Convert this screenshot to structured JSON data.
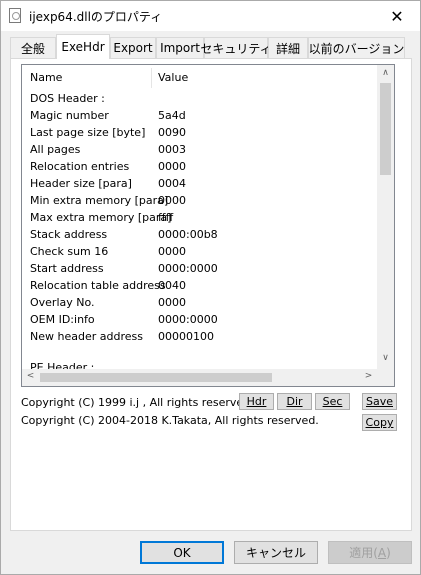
{
  "window": {
    "title": "ijexp64.dllのプロパティ",
    "close_glyph": "✕"
  },
  "tabs": [
    {
      "label": "全般"
    },
    {
      "label": "ExeHdr",
      "active": true
    },
    {
      "label": "Export"
    },
    {
      "label": "Import"
    },
    {
      "label": "セキュリティ"
    },
    {
      "label": "詳細"
    },
    {
      "label": "以前のバージョン"
    }
  ],
  "list": {
    "columns": [
      "Name",
      "Value"
    ],
    "rows": [
      {
        "name": "DOS Header :",
        "value": ""
      },
      {
        "name": "Magic number",
        "value": "5a4d"
      },
      {
        "name": "Last page size [byte]",
        "value": "0090"
      },
      {
        "name": "All pages",
        "value": "0003"
      },
      {
        "name": "Relocation entries",
        "value": "0000"
      },
      {
        "name": "Header size [para]",
        "value": "0004"
      },
      {
        "name": "Min extra memory [para]",
        "value": "0000"
      },
      {
        "name": "Max extra memory [para]",
        "value": "ffff"
      },
      {
        "name": "Stack address",
        "value": "0000:00b8"
      },
      {
        "name": "Check sum 16",
        "value": "0000"
      },
      {
        "name": "Start address",
        "value": "0000:0000"
      },
      {
        "name": "Relocation table address",
        "value": "0040"
      },
      {
        "name": "Overlay No.",
        "value": "0000"
      },
      {
        "name": "OEM ID:info",
        "value": "0000:0000"
      },
      {
        "name": "New header address",
        "value": "00000100"
      },
      {
        "name": "",
        "value": ""
      },
      {
        "name": "PE Header :",
        "value": ""
      }
    ]
  },
  "footer": {
    "copyright1": "Copyright (C) 1999 i.j , All rights reserved.",
    "copyright2": "Copyright (C) 2004-2018 K.Takata, All rights reserved.",
    "buttons": {
      "hdr": "Hdr",
      "dir": "Dir",
      "sec": "Sec",
      "save": "Save",
      "copy": "Copy"
    }
  },
  "dialog": {
    "ok": "OK",
    "cancel": "キャンセル",
    "apply_prefix": "適用(",
    "apply_key": "A",
    "apply_suffix": ")"
  },
  "icons": {
    "scroll_up": "∧",
    "scroll_down": "∨",
    "scroll_left": "<",
    "scroll_right": ">"
  }
}
